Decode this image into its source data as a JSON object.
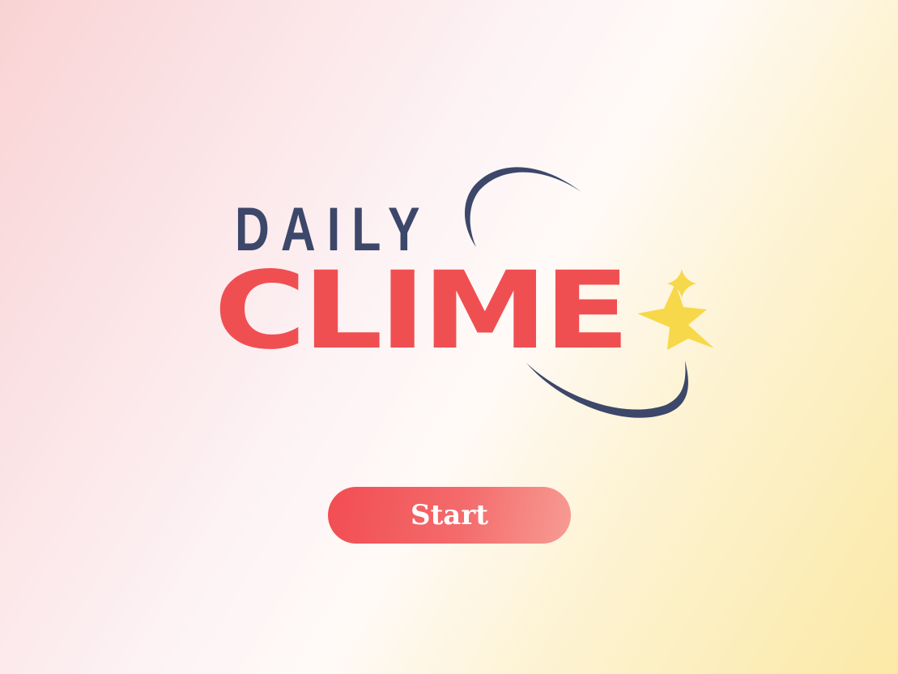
{
  "logo": {
    "line1": "DAILY",
    "line2": "CLIME",
    "colors": {
      "navy": "#3c476a",
      "red": "#f04f52",
      "star": "#f7d84a"
    },
    "icons": [
      "orbit-arc",
      "star-icon",
      "sparkle-icon"
    ]
  },
  "start_button": {
    "label": "Start",
    "color": "#f14d52"
  }
}
